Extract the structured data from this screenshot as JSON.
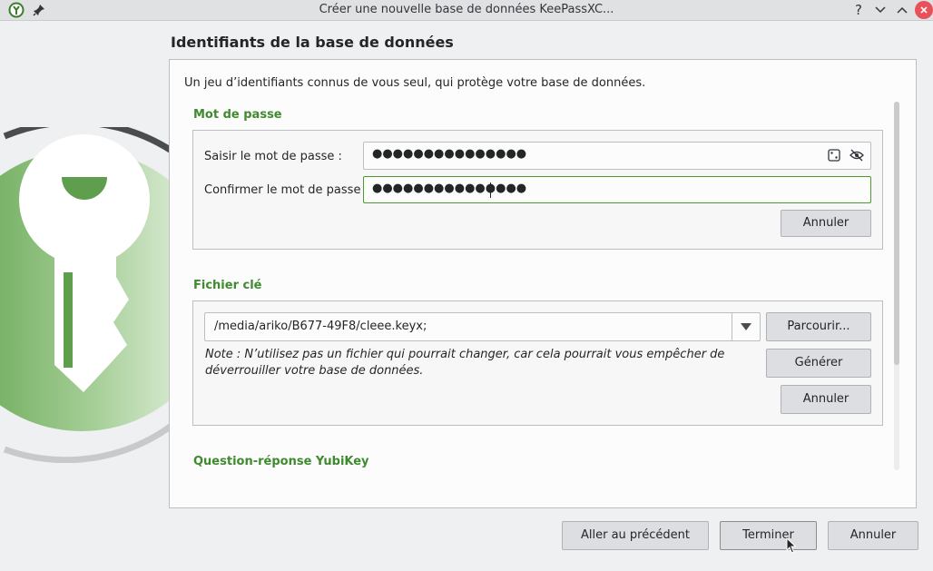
{
  "window": {
    "title": "Créer une nouvelle base de données KeePassXC...",
    "help_label": "?"
  },
  "page": {
    "heading": "Identifiants de la base de données",
    "intro": "Un jeu d’identifiants connus de vous seul, qui protège votre base de données."
  },
  "password": {
    "section_title": "Mot de passe",
    "enter_label": "Saisir le mot de passe :",
    "enter_value": "●●●●●●●●●●●●●●●",
    "confirm_label": "Confirmer le mot de passe :",
    "confirm_value": "●●●●●●●●●●●●●●●",
    "cancel_label": "Annuler"
  },
  "keyfile": {
    "section_title": "Fichier clé",
    "path": "/media/ariko/B677-49F8/cleee.keyx;",
    "browse_label": "Parcourir...",
    "generate_label": "Générer",
    "cancel_label": "Annuler",
    "note_line1": "Note : N’utilisez pas un fichier qui pourrait changer, car cela pourrait vous empêcher de",
    "note_line2": "déverrouiller votre base de données."
  },
  "yubikey": {
    "section_title": "Question-réponse YubiKey"
  },
  "footer": {
    "back_label": "Aller au précédent",
    "finish_label": "Terminer",
    "cancel_label": "Annuler"
  },
  "colors": {
    "accent_green": "#3f8a2f",
    "focus_border": "#4d9a2f",
    "close_red": "#e8515a"
  }
}
